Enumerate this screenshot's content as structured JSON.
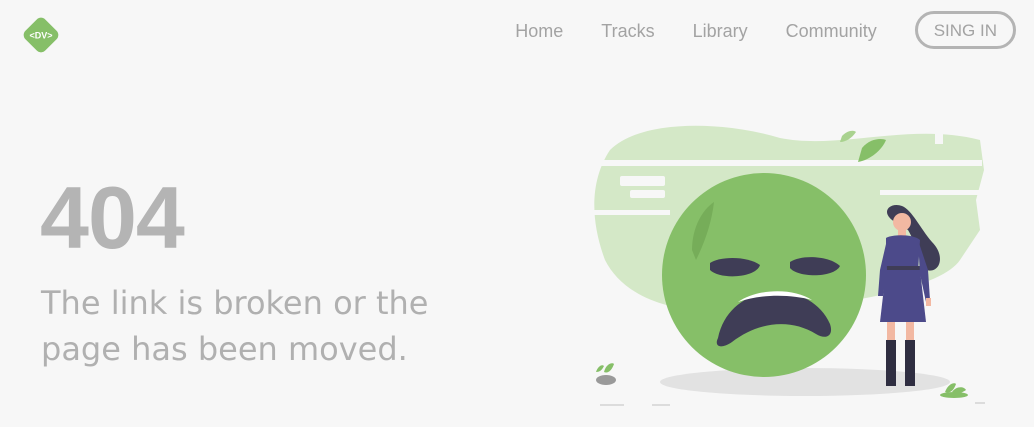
{
  "header": {
    "logo_text": "<DV>",
    "nav": [
      {
        "label": "Home"
      },
      {
        "label": "Tracks"
      },
      {
        "label": "Library"
      },
      {
        "label": "Community"
      }
    ],
    "signin_label": "SING IN"
  },
  "main": {
    "code": "404",
    "message": "The link is broken or the page has been moved."
  },
  "colors": {
    "background": "#f7f7f7",
    "accent_green": "#86bf68",
    "text_gray": "#b0b0b0",
    "face_dark": "#3f3d56"
  },
  "illustration": {
    "icon": "sad-face-illustration"
  }
}
